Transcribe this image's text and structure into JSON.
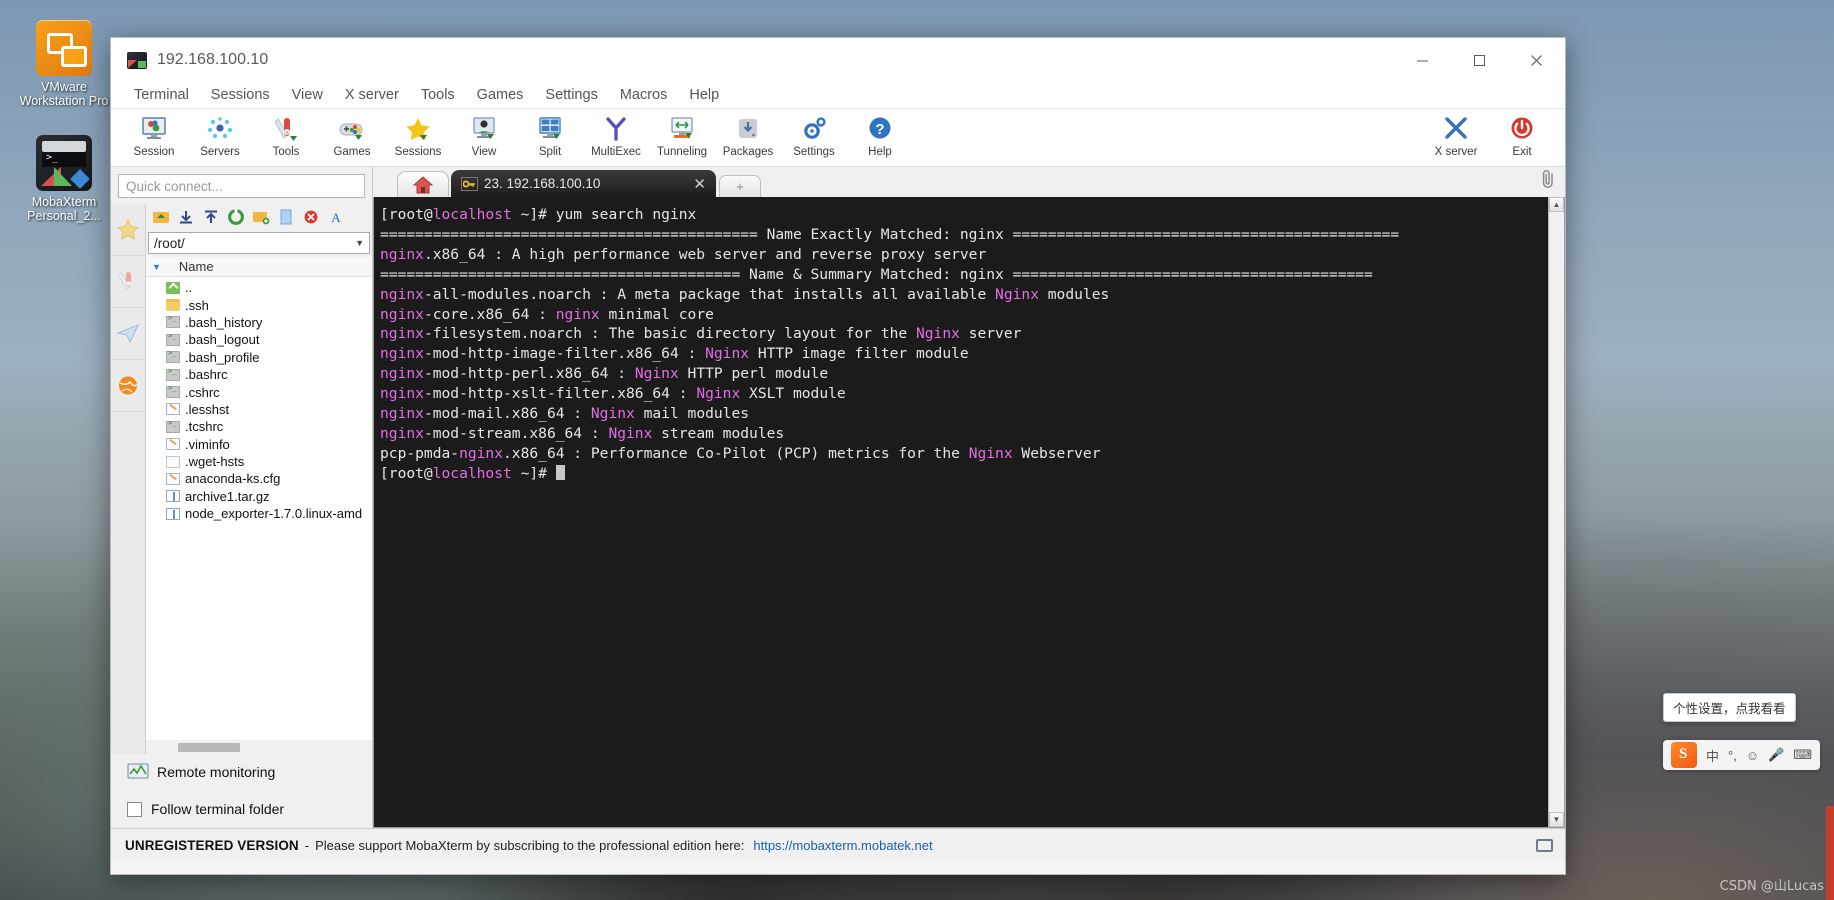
{
  "desktop": {
    "icons": [
      {
        "name": "vmware-workstation-pro",
        "label": "VMware Workstation Pro"
      },
      {
        "name": "mobaxterm-personal",
        "label": "MobaXterm Personal_2..."
      }
    ]
  },
  "window": {
    "title": "192.168.100.10",
    "icon": "mobaxterm-icon",
    "controls": {
      "minimize": "minimize-icon",
      "maximize": "maximize-icon",
      "close": "close-icon"
    }
  },
  "menubar": {
    "items": [
      "Terminal",
      "Sessions",
      "View",
      "X server",
      "Tools",
      "Games",
      "Settings",
      "Macros",
      "Help"
    ]
  },
  "toolbar": {
    "buttons": [
      {
        "label": "Session",
        "icon": "session-icon"
      },
      {
        "label": "Servers",
        "icon": "servers-icon"
      },
      {
        "label": "Tools",
        "icon": "tools-icon"
      },
      {
        "label": "Games",
        "icon": "games-icon"
      },
      {
        "label": "Sessions",
        "icon": "sessions-star-icon"
      },
      {
        "label": "View",
        "icon": "view-icon"
      },
      {
        "label": "Split",
        "icon": "split-icon"
      },
      {
        "label": "MultiExec",
        "icon": "multiexec-icon"
      },
      {
        "label": "Tunneling",
        "icon": "tunneling-icon"
      },
      {
        "label": "Packages",
        "icon": "packages-icon"
      },
      {
        "label": "Settings",
        "icon": "settings-gear-icon"
      },
      {
        "label": "Help",
        "icon": "help-icon"
      }
    ],
    "right_buttons": [
      {
        "label": "X server",
        "icon": "x-server-icon"
      },
      {
        "label": "Exit",
        "icon": "exit-power-icon"
      }
    ]
  },
  "sidebar": {
    "quick_connect_placeholder": "Quick connect...",
    "vertical_tabs": [
      {
        "name": "sessions-tab",
        "icon": "star-icon"
      },
      {
        "name": "tools-tab",
        "icon": "swiss-knife-icon"
      },
      {
        "name": "macros-tab",
        "icon": "paper-plane-icon"
      },
      {
        "name": "sftp-tab",
        "icon": "globe-icon"
      }
    ],
    "sftp_toolbar": [
      {
        "name": "go-up-button",
        "icon": "folder-up-icon"
      },
      {
        "name": "download-button",
        "icon": "download-icon"
      },
      {
        "name": "upload-button",
        "icon": "upload-icon"
      },
      {
        "name": "refresh-button",
        "icon": "refresh-icon"
      },
      {
        "name": "new-folder-button",
        "icon": "new-folder-icon"
      },
      {
        "name": "new-file-button",
        "icon": "new-file-icon"
      },
      {
        "name": "delete-button",
        "icon": "delete-icon"
      },
      {
        "name": "text-mode-button",
        "icon": "text-mode-icon"
      }
    ],
    "path": "/root/",
    "column_header": "Name",
    "files": [
      {
        "name": "..",
        "type": "up"
      },
      {
        "name": ".ssh",
        "type": "folder"
      },
      {
        "name": ".bash_history",
        "type": "term"
      },
      {
        "name": ".bash_logout",
        "type": "term"
      },
      {
        "name": ".bash_profile",
        "type": "term"
      },
      {
        "name": ".bashrc",
        "type": "term"
      },
      {
        "name": ".cshrc",
        "type": "term"
      },
      {
        "name": ".lesshst",
        "type": "doc"
      },
      {
        "name": ".tcshrc",
        "type": "term"
      },
      {
        "name": ".viminfo",
        "type": "doc"
      },
      {
        "name": ".wget-hsts",
        "type": "plain"
      },
      {
        "name": "anaconda-ks.cfg",
        "type": "doc"
      },
      {
        "name": "archive1.tar.gz",
        "type": "arch"
      },
      {
        "name": "node_exporter-1.7.0.linux-amd",
        "type": "arch"
      }
    ],
    "remote_monitoring_label": "Remote monitoring",
    "follow_terminal_folder_label": "Follow terminal folder",
    "follow_terminal_folder_checked": false
  },
  "tabs": {
    "home_tab_icon": "home-icon",
    "session_tab": {
      "label": "23. 192.168.100.10",
      "icon": "key-icon",
      "close": "close-icon"
    },
    "new_tab_label": "+",
    "clipboard_icon": "paperclip-icon"
  },
  "terminal": {
    "lines": [
      [
        {
          "t": "[root@",
          "c": "w"
        },
        {
          "t": "localhost",
          "c": "m"
        },
        {
          "t": " ~]# ",
          "c": "w"
        },
        {
          "t": "yum search nginx",
          "c": "w"
        }
      ],
      [
        {
          "t": "=========================================== Name Exactly Matched: nginx ============================================",
          "c": "w"
        }
      ],
      [
        {
          "t": "nginx",
          "c": "m"
        },
        {
          "t": ".x86_64 : A high performance web server and reverse proxy server",
          "c": "w"
        }
      ],
      [
        {
          "t": "========================================= Name & Summary Matched: nginx =========================================",
          "c": "w"
        }
      ],
      [
        {
          "t": "nginx",
          "c": "m"
        },
        {
          "t": "-all-modules.noarch : A meta package that installs all available ",
          "c": "w"
        },
        {
          "t": "Nginx",
          "c": "m"
        },
        {
          "t": " modules",
          "c": "w"
        }
      ],
      [
        {
          "t": "nginx",
          "c": "m"
        },
        {
          "t": "-core.x86_64 : ",
          "c": "w"
        },
        {
          "t": "nginx",
          "c": "m"
        },
        {
          "t": " minimal core",
          "c": "w"
        }
      ],
      [
        {
          "t": "nginx",
          "c": "m"
        },
        {
          "t": "-filesystem.noarch : The basic directory layout for the ",
          "c": "w"
        },
        {
          "t": "Nginx",
          "c": "m"
        },
        {
          "t": " server",
          "c": "w"
        }
      ],
      [
        {
          "t": "nginx",
          "c": "m"
        },
        {
          "t": "-mod-http-image-filter.x86_64 : ",
          "c": "w"
        },
        {
          "t": "Nginx",
          "c": "m"
        },
        {
          "t": " HTTP image filter module",
          "c": "w"
        }
      ],
      [
        {
          "t": "nginx",
          "c": "m"
        },
        {
          "t": "-mod-http-perl.x86_64 : ",
          "c": "w"
        },
        {
          "t": "Nginx",
          "c": "m"
        },
        {
          "t": " HTTP perl module",
          "c": "w"
        }
      ],
      [
        {
          "t": "nginx",
          "c": "m"
        },
        {
          "t": "-mod-http-xslt-filter.x86_64 : ",
          "c": "w"
        },
        {
          "t": "Nginx",
          "c": "m"
        },
        {
          "t": " XSLT module",
          "c": "w"
        }
      ],
      [
        {
          "t": "nginx",
          "c": "m"
        },
        {
          "t": "-mod-mail.x86_64 : ",
          "c": "w"
        },
        {
          "t": "Nginx",
          "c": "m"
        },
        {
          "t": " mail modules",
          "c": "w"
        }
      ],
      [
        {
          "t": "nginx",
          "c": "m"
        },
        {
          "t": "-mod-stream.x86_64 : ",
          "c": "w"
        },
        {
          "t": "Nginx",
          "c": "m"
        },
        {
          "t": " stream modules",
          "c": "w"
        }
      ],
      [
        {
          "t": "pcp-pmda-",
          "c": "w"
        },
        {
          "t": "nginx",
          "c": "m"
        },
        {
          "t": ".x86_64 : Performance Co-Pilot (PCP) metrics for the ",
          "c": "w"
        },
        {
          "t": "Nginx",
          "c": "m"
        },
        {
          "t": " Webserver",
          "c": "w"
        }
      ],
      [
        {
          "t": "[root@",
          "c": "w"
        },
        {
          "t": "localhost",
          "c": "m"
        },
        {
          "t": " ~]# ",
          "c": "w"
        },
        {
          "t": "",
          "c": "cursor"
        }
      ]
    ],
    "colors": {
      "background": "#1b1b1b",
      "foreground": "#e6e6e6",
      "magenta": "#e46ee4"
    },
    "scroll_up_icon": "chevron-up-icon",
    "scroll_down_icon": "chevron-down-icon"
  },
  "statusbar": {
    "unregistered": "UNREGISTERED VERSION",
    "dash": "-",
    "message": "Please support MobaXterm by subscribing to the professional edition here:",
    "link": "https://mobaxterm.mobatek.net",
    "monitor_icon": "monitor-icon"
  },
  "ime": {
    "tooltip": "个性设置，点我看看",
    "logo_icon": "sogou-logo-icon",
    "items": [
      {
        "name": "language-mode",
        "label": "中"
      },
      {
        "name": "punctuation-mode",
        "label": "°,"
      },
      {
        "name": "emoji-picker",
        "label": "☺"
      },
      {
        "name": "voice-input",
        "label": "🎤"
      },
      {
        "name": "keyboard-picker",
        "label": "⌨"
      }
    ]
  },
  "watermark": "CSDN @山Lucas"
}
